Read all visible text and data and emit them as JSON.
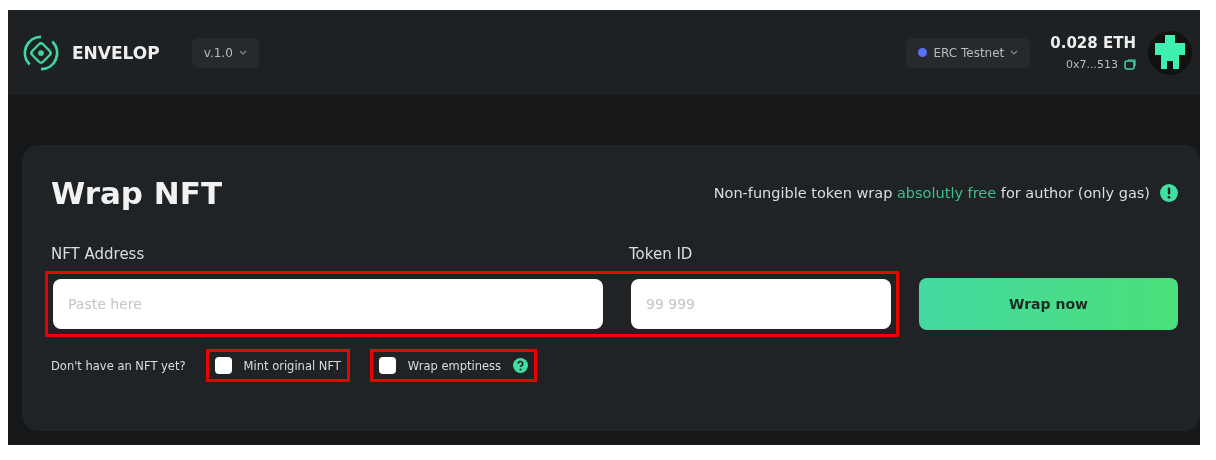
{
  "header": {
    "brand": "ENVELOP",
    "version": "v.1.0",
    "network": {
      "label": "ERC Testnet",
      "color": "#5b6ef5"
    },
    "balance": "0.028 ETH",
    "address": "0x7...513"
  },
  "card": {
    "title": "Wrap NFT",
    "note": {
      "before": "Non-fungible token wrap ",
      "highlight": "absolutly free",
      "after": " for author (only gas)"
    },
    "fields": [
      {
        "label": "NFT Address",
        "placeholder": "Paste here"
      },
      {
        "label": "Token ID",
        "placeholder": "99 999"
      }
    ],
    "button": "Wrap now",
    "hint": "Don't have an NFT yet?",
    "options": [
      {
        "label": "Mint original NFT",
        "checked": false,
        "help": false
      },
      {
        "label": "Wrap emptiness",
        "checked": false,
        "help": true
      }
    ]
  }
}
